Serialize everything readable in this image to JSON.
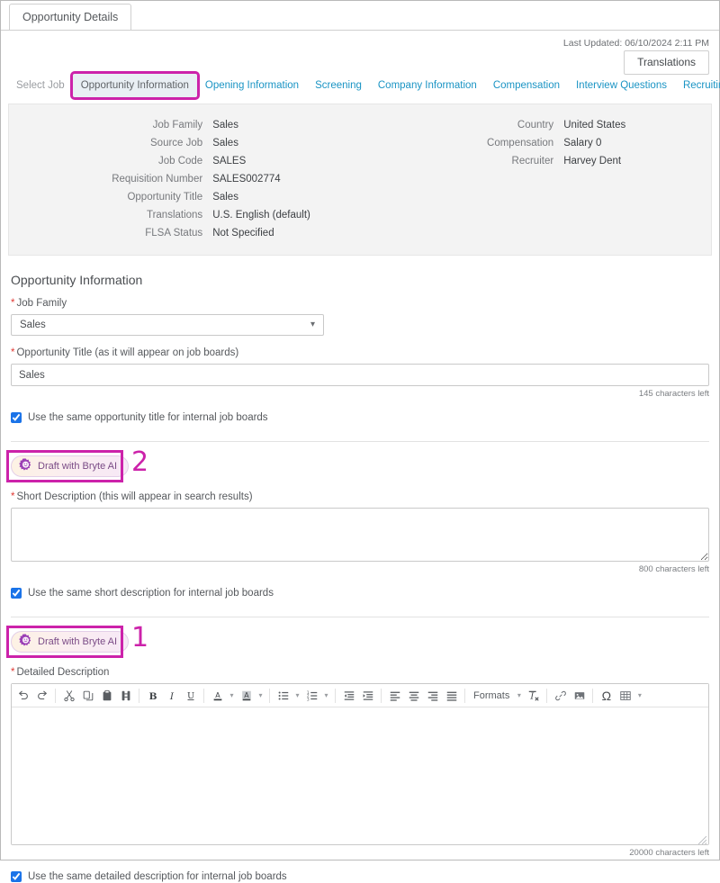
{
  "window": {
    "tab_label": "Opportunity Details"
  },
  "header": {
    "last_updated": "Last Updated: 06/10/2024 2:11 PM",
    "translations_label": "Translations"
  },
  "step_tabs": [
    {
      "label": "Select Job",
      "state": "disabled"
    },
    {
      "label": "Opportunity Information",
      "state": "active"
    },
    {
      "label": "Opening Information",
      "state": "link"
    },
    {
      "label": "Screening",
      "state": "link"
    },
    {
      "label": "Company Information",
      "state": "link"
    },
    {
      "label": "Compensation",
      "state": "link"
    },
    {
      "label": "Interview Questions",
      "state": "link"
    },
    {
      "label": "Recruiting Process",
      "state": "link"
    }
  ],
  "summary": {
    "left": [
      {
        "label": "Job Family",
        "value": "Sales"
      },
      {
        "label": "Source Job",
        "value": "Sales"
      },
      {
        "label": "Job Code",
        "value": "SALES"
      },
      {
        "label": "Requisition Number",
        "value": "SALES002774"
      },
      {
        "label": "Opportunity Title",
        "value": "Sales"
      },
      {
        "label": "Translations",
        "value": "U.S. English (default)"
      },
      {
        "label": "FLSA Status",
        "value": "Not Specified"
      }
    ],
    "right": [
      {
        "label": "Country",
        "value": "United States"
      },
      {
        "label": "Compensation",
        "value": "Salary 0"
      },
      {
        "label": "Recruiter",
        "value": "Harvey Dent"
      }
    ]
  },
  "form": {
    "section_title": "Opportunity Information",
    "job_family": {
      "label": "Job Family",
      "required": true,
      "value": "Sales",
      "options": [
        "Sales"
      ]
    },
    "opportunity_title": {
      "label": "Opportunity Title (as it will appear on job boards)",
      "required": true,
      "value": "Sales",
      "placeholder": "",
      "chars_left": "145 characters left",
      "checkbox_label": "Use the same opportunity title for internal job boards",
      "checked": true
    },
    "short_description": {
      "label": "Short Description (this will appear in search results)",
      "required": true,
      "value": "",
      "placeholder": "",
      "chars_left": "800 characters left",
      "checkbox_label": "Use the same short description for internal job boards",
      "checked": true
    },
    "detailed_description": {
      "label": "Detailed Description",
      "required": true,
      "value": "",
      "chars_left": "20000 characters left",
      "checkbox_label": "Use the same detailed description for internal job boards",
      "checked": true
    }
  },
  "ai_buttons": {
    "label": "Draft with Bryte AI",
    "icon": "bryte-ai-sparkle-icon",
    "short_description_step": "2",
    "detailed_description_step": "1"
  },
  "editor_toolbar": {
    "formats_label": "Formats",
    "special_char_glyph": "Ω",
    "buttons": [
      "undo-icon",
      "redo-icon",
      "cut-icon",
      "copy-icon",
      "paste-icon",
      "find-replace-icon",
      "bold-icon",
      "italic-icon",
      "underline-icon",
      "text-color-icon",
      "background-color-icon",
      "bullet-list-icon",
      "numbered-list-icon",
      "outdent-icon",
      "indent-icon",
      "align-left-icon",
      "align-center-icon",
      "align-right-icon",
      "align-justify-icon",
      "formats-dropdown",
      "clear-formatting-icon",
      "link-icon",
      "image-icon",
      "special-character-icon",
      "table-icon"
    ]
  },
  "colors": {
    "annotation": "#cc22aa",
    "link": "#1a94c4",
    "required": "#e03a35",
    "active_tab_bg": "#e9eff4",
    "checkbox": "#1a73e8"
  }
}
